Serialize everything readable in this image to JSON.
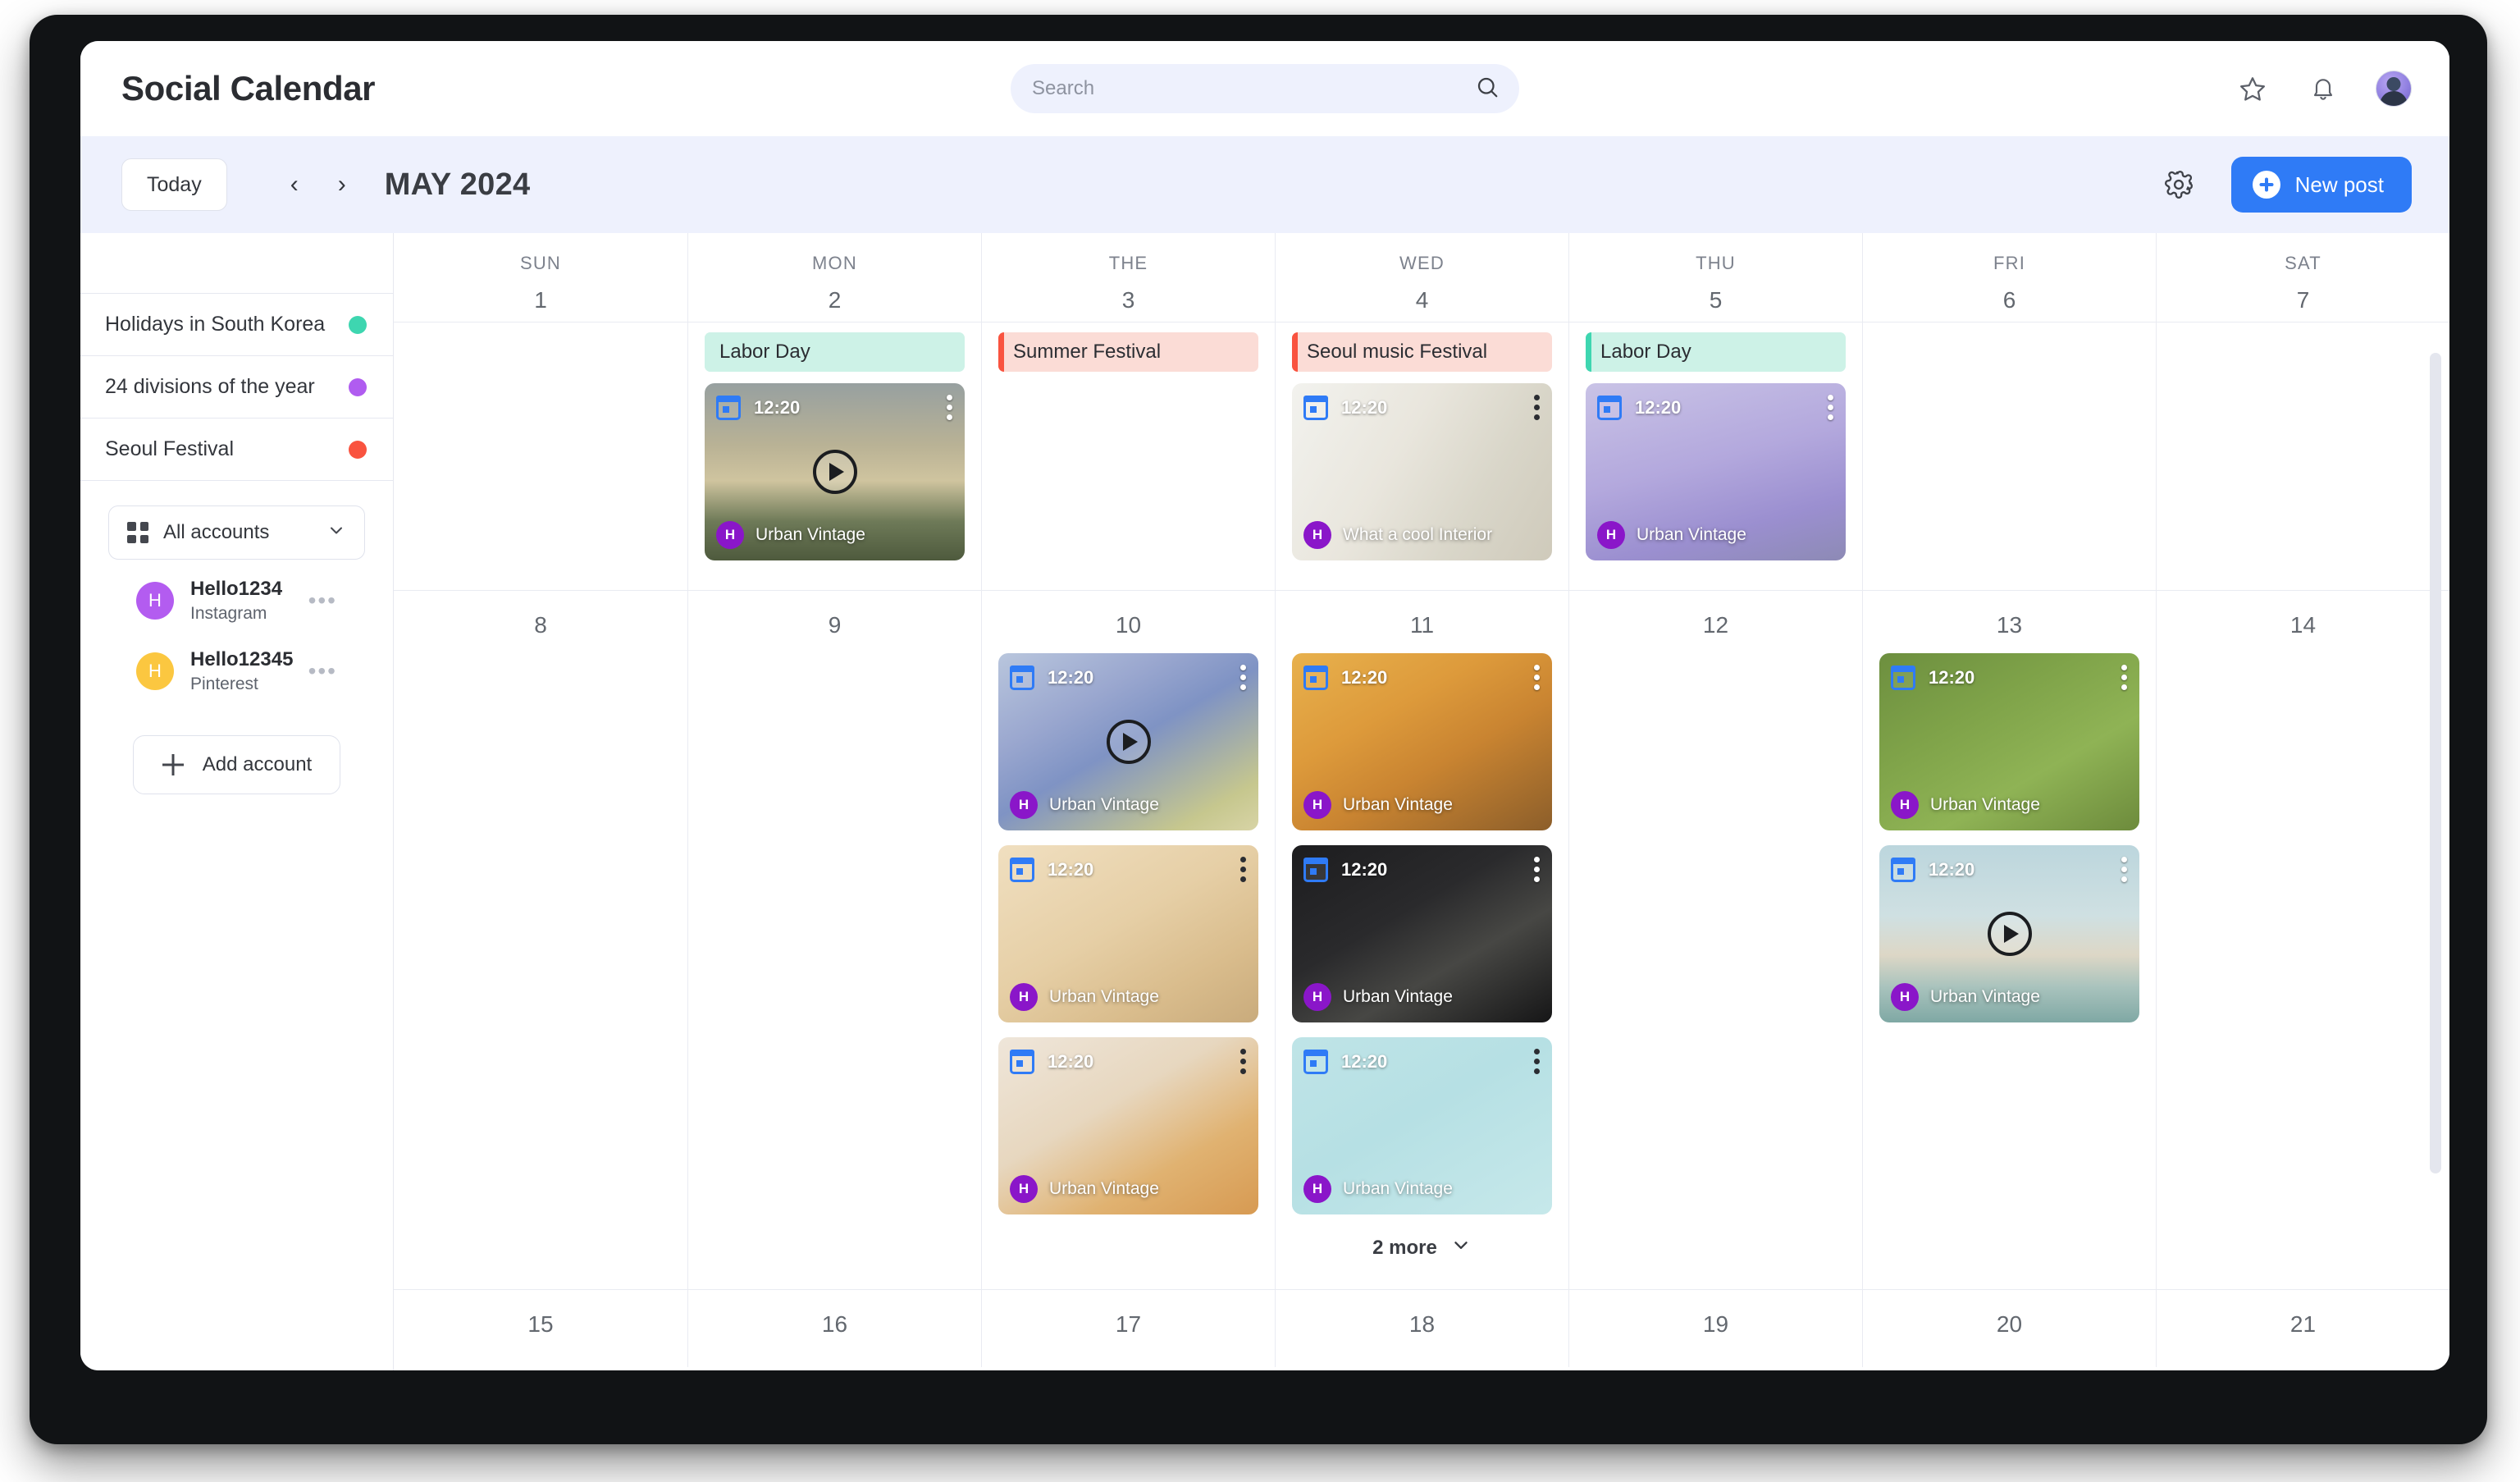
{
  "app": {
    "title": "Social Calendar"
  },
  "search": {
    "placeholder": "Search",
    "value": "",
    "icon": "search-icon"
  },
  "topbar_icons": {
    "favorite": "star-icon",
    "notifications": "bell-icon",
    "profile": "avatar"
  },
  "toolbar": {
    "today_label": "Today",
    "prev_label": "‹",
    "next_label": "›",
    "month_title": "MAY 2024",
    "settings_icon": "gear-icon",
    "new_post_label": "New post"
  },
  "sidebar": {
    "calendars": [
      {
        "label": "Holidays in South Korea",
        "color": "#3ed6b0"
      },
      {
        "label": "24 divisions of the year",
        "color": "#b05cf0"
      },
      {
        "label": "Seoul Festival",
        "color": "#f9533f"
      }
    ],
    "account_selector": {
      "label": "All accounts",
      "icon": "grid-icon",
      "chevron": "chevron-down-icon"
    },
    "accounts": [
      {
        "initial": "H",
        "name": "Hello1234",
        "network": "Instagram",
        "color": "#b35cf0",
        "menu": "•••"
      },
      {
        "initial": "H",
        "name": "Hello12345",
        "network": "Pinterest",
        "color": "#fbc740",
        "menu": "•••"
      }
    ],
    "add_account_label": "Add account"
  },
  "calendar": {
    "weekdays": [
      "SUN",
      "MON",
      "THE",
      "WED",
      "THU",
      "FRI",
      "SAT"
    ],
    "weeks": [
      {
        "days": [
          {
            "num": "1",
            "events": [],
            "posts": []
          },
          {
            "num": "2",
            "events": [
              {
                "title": "Labor Day",
                "bg": "#cdf2e7",
                "bar": "#cdf2e7"
              }
            ],
            "posts": [
              {
                "time": "12:20",
                "caption": "Urban Vintage",
                "avatar_color": "#8a16c9",
                "video": true,
                "img": "mountain-sunset"
              }
            ]
          },
          {
            "num": "3",
            "events": [
              {
                "title": "Summer Festival",
                "bg": "#fbdcd6",
                "bar": "#f9533f"
              }
            ],
            "posts": []
          },
          {
            "num": "4",
            "events": [
              {
                "title": "Seoul music Festival",
                "bg": "#fbdcd6",
                "bar": "#f9533f"
              }
            ],
            "posts": [
              {
                "time": "12:20",
                "caption": "What a cool Interior",
                "avatar_color": "#8a16c9",
                "video": false,
                "img": "bright-interior"
              }
            ]
          },
          {
            "num": "5",
            "events": [
              {
                "title": "Labor Day",
                "bg": "#cdf2e7",
                "bar": "#3ed6b0"
              }
            ],
            "posts": [
              {
                "time": "12:20",
                "caption": "Urban Vintage",
                "avatar_color": "#8a16c9",
                "video": false,
                "img": "lavender"
              }
            ]
          },
          {
            "num": "6",
            "events": [],
            "posts": []
          },
          {
            "num": "7",
            "events": [],
            "posts": []
          }
        ]
      },
      {
        "days": [
          {
            "num": "8",
            "events": [],
            "posts": []
          },
          {
            "num": "9",
            "events": [],
            "posts": []
          },
          {
            "num": "10",
            "events": [],
            "posts": [
              {
                "time": "12:20",
                "caption": "Urban Vintage",
                "avatar_color": "#8a16c9",
                "video": true,
                "img": "painting-iris"
              },
              {
                "time": "12:20",
                "caption": "Urban Vintage",
                "avatar_color": "#8a16c9",
                "video": false,
                "img": "warm-room"
              },
              {
                "time": "12:20",
                "caption": "Urban Vintage",
                "avatar_color": "#8a16c9",
                "video": false,
                "img": "cocktail"
              }
            ]
          },
          {
            "num": "11",
            "events": [],
            "posts": [
              {
                "time": "12:20",
                "caption": "Urban Vintage",
                "avatar_color": "#8a16c9",
                "video": false,
                "img": "burger"
              },
              {
                "time": "12:20",
                "caption": "Urban Vintage",
                "avatar_color": "#8a16c9",
                "video": false,
                "img": "pasta-dark"
              },
              {
                "time": "12:20",
                "caption": "Urban Vintage",
                "avatar_color": "#8a16c9",
                "video": false,
                "img": "colorful-hair"
              }
            ],
            "more_label": "2 more"
          },
          {
            "num": "12",
            "events": [],
            "posts": []
          },
          {
            "num": "13",
            "events": [],
            "posts": [
              {
                "time": "12:20",
                "caption": "Urban Vintage",
                "avatar_color": "#8a16c9",
                "video": false,
                "img": "raccoon"
              },
              {
                "time": "12:20",
                "caption": "Urban Vintage",
                "avatar_color": "#8a16c9",
                "video": true,
                "img": "lake-mountains"
              }
            ]
          },
          {
            "num": "14",
            "events": [],
            "posts": []
          }
        ]
      },
      {
        "days": [
          {
            "num": "15",
            "events": [],
            "posts": []
          },
          {
            "num": "16",
            "events": [],
            "posts": []
          },
          {
            "num": "17",
            "events": [],
            "posts": []
          },
          {
            "num": "18",
            "events": [],
            "posts": []
          },
          {
            "num": "19",
            "events": [],
            "posts": []
          },
          {
            "num": "20",
            "events": [],
            "posts": []
          },
          {
            "num": "21",
            "events": [],
            "posts": []
          }
        ]
      }
    ]
  },
  "colors": {
    "accent": "#2f7bf6",
    "page_bg": "#eef1fd",
    "panel": "#ffffff"
  }
}
